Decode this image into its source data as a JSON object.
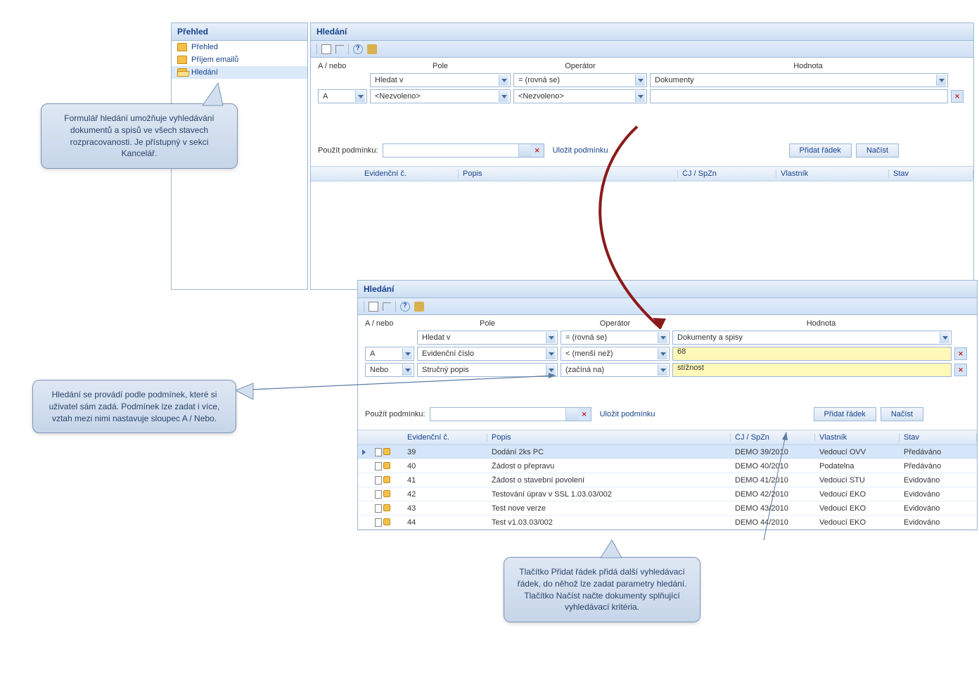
{
  "sidebar": {
    "title": "Přehled",
    "items": [
      {
        "label": "Přehled",
        "selected": false
      },
      {
        "label": "Příjem emailů",
        "selected": false
      },
      {
        "label": "Hledání",
        "selected": true
      }
    ]
  },
  "panel1": {
    "title": "Hledání",
    "cond_head": {
      "col_anebo": "A / nebo",
      "col_pole": "Pole",
      "col_operator": "Operátor",
      "col_hodnota": "Hodnota"
    },
    "rows": [
      {
        "anebo": "",
        "pole": "Hledat v",
        "operator": "=  (rovná se)",
        "hodnota": "Dokumenty",
        "hodnota_is_combo": true,
        "del": false
      },
      {
        "anebo": "A",
        "pole": "<Nezvoleno>",
        "operator": "<Nezvoleno>",
        "hodnota": "",
        "hodnota_is_combo": false,
        "del": true
      }
    ],
    "usecond_label": "Použít podmínku:",
    "savecond_label": "Uložit podmínku",
    "btn_addrow": "Přidat řádek",
    "btn_load": "Načíst",
    "grid_cols": {
      "evc": "Evidenční č.",
      "popis": "Popis",
      "cj": "ČJ / SpZn",
      "vlastnik": "Vlastník",
      "stav": "Stav"
    }
  },
  "panel2": {
    "title": "Hledání",
    "cond_head": {
      "col_anebo": "A / nebo",
      "col_pole": "Pole",
      "col_operator": "Operátor",
      "col_hodnota": "Hodnota"
    },
    "rows": [
      {
        "anebo": "",
        "pole": "Hledat v",
        "operator": "=  (rovná se)",
        "hodnota": "Dokumenty a spisy",
        "hodnota_is_combo": true,
        "hl": false,
        "del": false
      },
      {
        "anebo": "A",
        "pole": "Evidenční číslo",
        "operator": "<   (menší než)",
        "hodnota": "68",
        "hodnota_is_combo": false,
        "hl": true,
        "del": true
      },
      {
        "anebo": "Nebo",
        "pole": "Stručný popis",
        "operator": "(začíná na)",
        "hodnota": "stížnost",
        "hodnota_is_combo": false,
        "hl": true,
        "del": true
      }
    ],
    "usecond_label": "Použít podmínku:",
    "savecond_label": "Uložit podmínku",
    "btn_addrow": "Přidat řádek",
    "btn_load": "Načíst",
    "grid_cols": {
      "evc": "Evidenční č.",
      "popis": "Popis",
      "cj": "ČJ / SpZn",
      "vlastnik": "Vlastník",
      "stav": "Stav"
    },
    "grid_rows": [
      {
        "evc": "39",
        "popis": "Dodání 2ks PC",
        "cj": "DEMO 39/2010",
        "vlastnik": "Vedoucí OVV",
        "stav": "Předáváno",
        "selected": true
      },
      {
        "evc": "40",
        "popis": "Žádost o přepravu",
        "cj": "DEMO 40/2010",
        "vlastnik": "Podatelna",
        "stav": "Předáváno"
      },
      {
        "evc": "41",
        "popis": "Žádost o stavební povolení",
        "cj": "DEMO 41/2010",
        "vlastnik": "Vedoucí STU",
        "stav": "Evidováno"
      },
      {
        "evc": "42",
        "popis": "Testování úprav v SSL 1.03.03/002",
        "cj": "DEMO 42/2010",
        "vlastnik": "Vedoucí EKO",
        "stav": "Evidováno"
      },
      {
        "evc": "43",
        "popis": "Test nove verze",
        "cj": "DEMO 43/2010",
        "vlastnik": "Vedoucí EKO",
        "stav": "Evidováno"
      },
      {
        "evc": "44",
        "popis": "Test v1.03.03/002",
        "cj": "DEMO 44/2010",
        "vlastnik": "Vedoucí EKO",
        "stav": "Evidováno"
      }
    ]
  },
  "callouts": {
    "c1": "Formulář hledání umožňuje vyhledávání dokumentů a spisů ve všech stavech rozpracovanosti. Je přístupný v sekci Kancelář.",
    "c2": "Hledání se provádí podle podmínek, které si uživatel sám zadá. Podmínek lze zadat i více, vztah mezi nimi nastavuje sloupec A / Nebo.",
    "c3": "Tlačítko Přidat řádek přidá další vyhledávací řádek, do něhož lze zadat parametry hledání. Tlačítko Načíst načte dokumenty splňující vyhledávací kritéria."
  }
}
